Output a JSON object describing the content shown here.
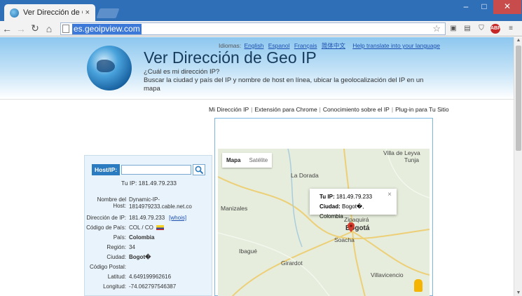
{
  "browser": {
    "tab_title": "Ver Dirección de Geo IP",
    "tab_close": "×",
    "url": "es.geoipview.com"
  },
  "header": {
    "lang_prefix": "Idiomas:",
    "languages": [
      "English",
      "Espanol",
      "Français",
      "简体中文"
    ],
    "translate_link": "Help translate into your language",
    "title": "Ver Dirección de Geo IP",
    "subtitle_1": "¿Cuál es mi dirección IP?",
    "subtitle_2": "Buscar la ciudad y país del IP y nombre de host en línea, ubicar la geolocalización del IP en un mapa"
  },
  "nav": [
    "Mi Dirección IP",
    "Extensión para Chrome",
    "Conocimiento sobre el IP",
    "Plug-in para Tu Sitio"
  ],
  "search": {
    "label": "Host/IP:",
    "value": ""
  },
  "tu_ip": "Tu IP: 181.49.79.233",
  "info": {
    "host_label": "Nombre del Host:",
    "host_value_1": "Dynamic-IP-",
    "host_value_2": "1814979233.cable.net.co",
    "ip_label": "Dirección de IP:",
    "ip_value": "181.49.79.233",
    "whois": "[whois]",
    "country_code_label": "Código de País:",
    "country_code_value": "COL / CO",
    "country_label": "País:",
    "country_value": "Colombia",
    "region_label": "Región:",
    "region_value": "34",
    "city_label": "Ciudad:",
    "city_value": "Bogot�",
    "postal_label": "Código Postal:",
    "postal_value": "",
    "lat_label": "Latitud:",
    "lat_value": "4.649199962616",
    "lon_label": "Longitud:",
    "lon_value": "-74.062797546387"
  },
  "map": {
    "type_map": "Mapa",
    "type_sat": "Satélite",
    "places": {
      "villa": "Villa de Leyva",
      "tunja": "Tunja",
      "dorada": "La Dorada",
      "zipaq": "Zipaquirá",
      "manizales": "Manizales",
      "bogota": "Bogotá",
      "ibague": "Ibagué",
      "soacha": "Soacha",
      "girardot": "Girardot",
      "villavicencio": "Villavicencio"
    },
    "popup_ip_label": "Tu IP:",
    "popup_ip": "181.49.79.233",
    "popup_city_label": "Ciudad:",
    "popup_city": "Bogot�, Colombia",
    "popup_close": "×"
  },
  "colors": {
    "accent": "#2b7bc0",
    "title": "#163a5c",
    "link": "#1a4fb0"
  },
  "icons": [
    "back-icon",
    "forward-icon",
    "reload-icon",
    "home-icon",
    "star-icon",
    "search-icon",
    "map-pin-icon",
    "pegman-icon"
  ]
}
